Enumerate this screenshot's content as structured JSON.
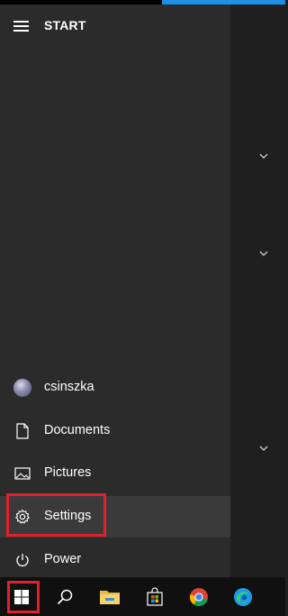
{
  "header": {
    "title": "START"
  },
  "user": {
    "name": "csinszka"
  },
  "menu": {
    "documents": "Documents",
    "pictures": "Pictures",
    "settings": "Settings",
    "power": "Power"
  },
  "icons": {
    "hamburger": "hamburger-menu-icon",
    "chevron": "chevron-down-icon",
    "documents": "document-icon",
    "pictures": "pictures-icon",
    "settings": "gear-icon",
    "power": "power-icon",
    "start": "windows-logo-icon",
    "search": "search-icon",
    "explorer": "folder-icon",
    "store": "store-bag-icon",
    "chrome": "chrome-icon",
    "edge": "edge-icon"
  },
  "colors": {
    "panel": "#2b2b2b",
    "tiles": "#1f1f1f",
    "taskbar": "#101010",
    "accent": "#1e90e6",
    "highlight": "#e0202c",
    "hover": "#3a3a3a"
  }
}
